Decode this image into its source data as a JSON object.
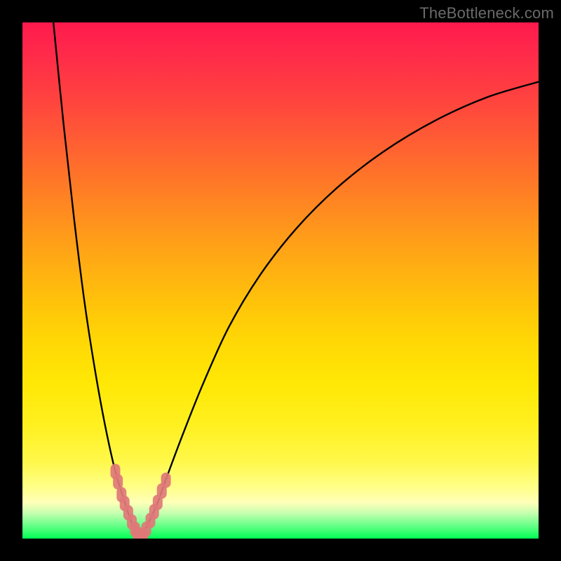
{
  "watermark": "TheBottleneck.com",
  "colors": {
    "background": "#000000",
    "gradient_top": "#ff1a4d",
    "gradient_bottom": "#00ff55",
    "curve": "#000000",
    "marker": "#e07878"
  },
  "chart_data": {
    "type": "line",
    "title": "",
    "xlabel": "",
    "ylabel": "",
    "xlim": [
      0,
      100
    ],
    "ylim": [
      0,
      100
    ],
    "grid": false,
    "legend": false,
    "notes": "V-shaped bottleneck curve; axes have no visible tick labels. Markers cluster near the x-axis around x≈18–28. Values estimated from pixel position.",
    "series": [
      {
        "name": "left-branch",
        "x": [
          6,
          8,
          10,
          12,
          14,
          16,
          18,
          20,
          21,
          22,
          22.7
        ],
        "values": [
          100,
          80,
          62,
          46,
          33,
          22,
          13,
          6.5,
          3.5,
          1.5,
          0.2
        ]
      },
      {
        "name": "right-branch",
        "x": [
          22.7,
          24,
          26,
          28,
          31,
          35,
          40,
          46,
          53,
          61,
          70,
          80,
          90,
          100
        ],
        "values": [
          0.2,
          2.2,
          6.5,
          12,
          20,
          30,
          41,
          51,
          60,
          68,
          75,
          81,
          85.5,
          88.5
        ]
      }
    ],
    "markers": [
      {
        "x": 18.0,
        "y": 13.0
      },
      {
        "x": 18.5,
        "y": 11.0
      },
      {
        "x": 19.2,
        "y": 8.5
      },
      {
        "x": 19.8,
        "y": 6.8
      },
      {
        "x": 20.5,
        "y": 5.0
      },
      {
        "x": 21.2,
        "y": 3.2
      },
      {
        "x": 21.8,
        "y": 1.8
      },
      {
        "x": 22.3,
        "y": 0.9
      },
      {
        "x": 22.8,
        "y": 0.3
      },
      {
        "x": 23.4,
        "y": 0.7
      },
      {
        "x": 24.0,
        "y": 1.8
      },
      {
        "x": 24.8,
        "y": 3.5
      },
      {
        "x": 25.5,
        "y": 5.2
      },
      {
        "x": 26.2,
        "y": 7.0
      },
      {
        "x": 27.0,
        "y": 9.2
      },
      {
        "x": 27.8,
        "y": 11.3
      }
    ]
  }
}
